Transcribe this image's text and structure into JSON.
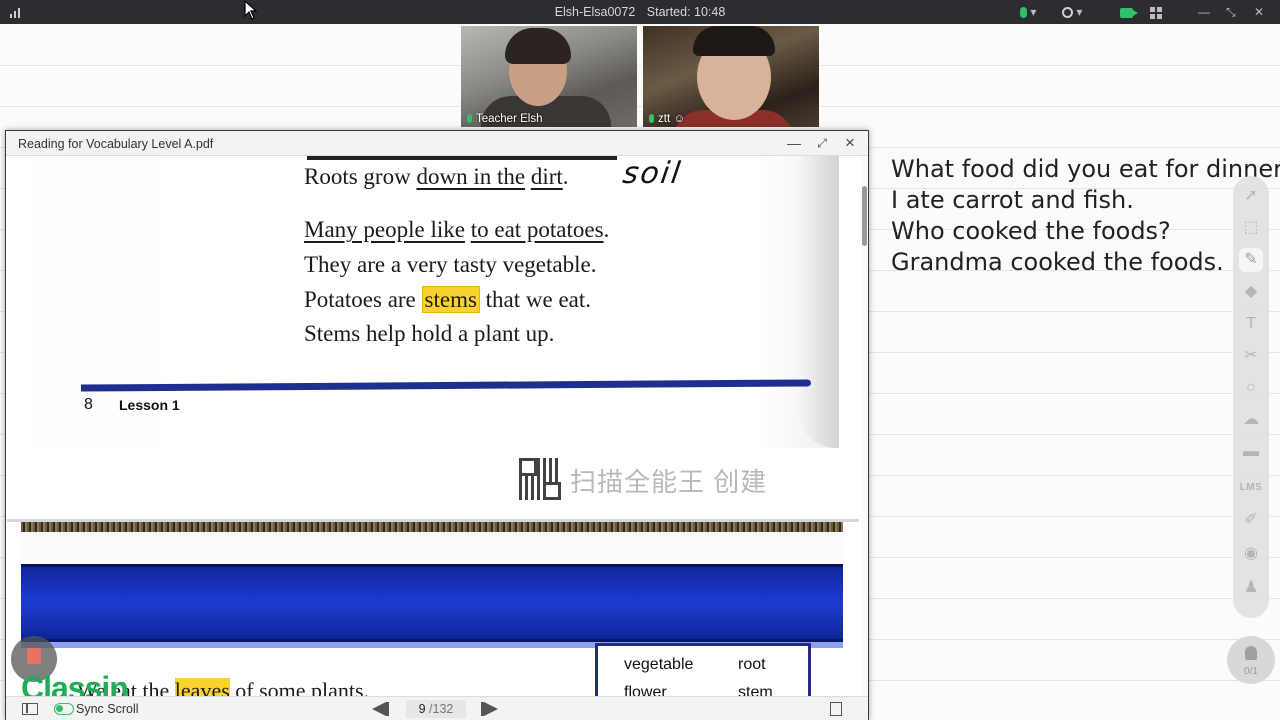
{
  "topbar": {
    "session_id": "Elsh-Elsa0072",
    "started": "Started: 10:48"
  },
  "videos": [
    {
      "name": "Teacher Elsh"
    },
    {
      "name": "ztt"
    }
  ],
  "pdf": {
    "filename": "Reading for Vocabulary Level A.pdf",
    "page1": {
      "line1": {
        "a": "Roots grow ",
        "b": "down in the",
        "c": " ",
        "d": "dirt",
        "e": "."
      },
      "handwriting": "soil",
      "line2": {
        "a": "Many people like",
        "b": " ",
        "c": "to eat potatoes",
        "d": "."
      },
      "line3": "They are a very tasty vegetable.",
      "line4": {
        "a": "Potatoes are ",
        "b": "stems",
        "c": " that we eat."
      },
      "line5": "Stems help hold a plant up.",
      "page_number": "8",
      "lesson": "Lesson  1",
      "scanner_watermark": "扫描全能王 创建"
    },
    "page2": {
      "vocab": [
        "vegetable",
        "root",
        "flower",
        "stem"
      ],
      "partial_line": {
        "a": "We eat the ",
        "b": "leaves",
        "c": " of some plants."
      }
    },
    "footer": {
      "sync_label": "Sync Scroll",
      "current_page": "9",
      "total_pages": "/132"
    }
  },
  "whiteboard": {
    "lines": [
      "What food did you eat for dinner?",
      "I ate carrot and fish.",
      "Who cooked the foods?",
      "Grandma cooked the foods."
    ]
  },
  "brand": "Classin",
  "tools": {
    "lms_label": "LMS",
    "text_tool": "T",
    "helper_count": "0/1"
  },
  "colors": {
    "accent_green": "#2fc06a",
    "highlight": "#f9d230",
    "band_blue": "#1d3bd1"
  }
}
